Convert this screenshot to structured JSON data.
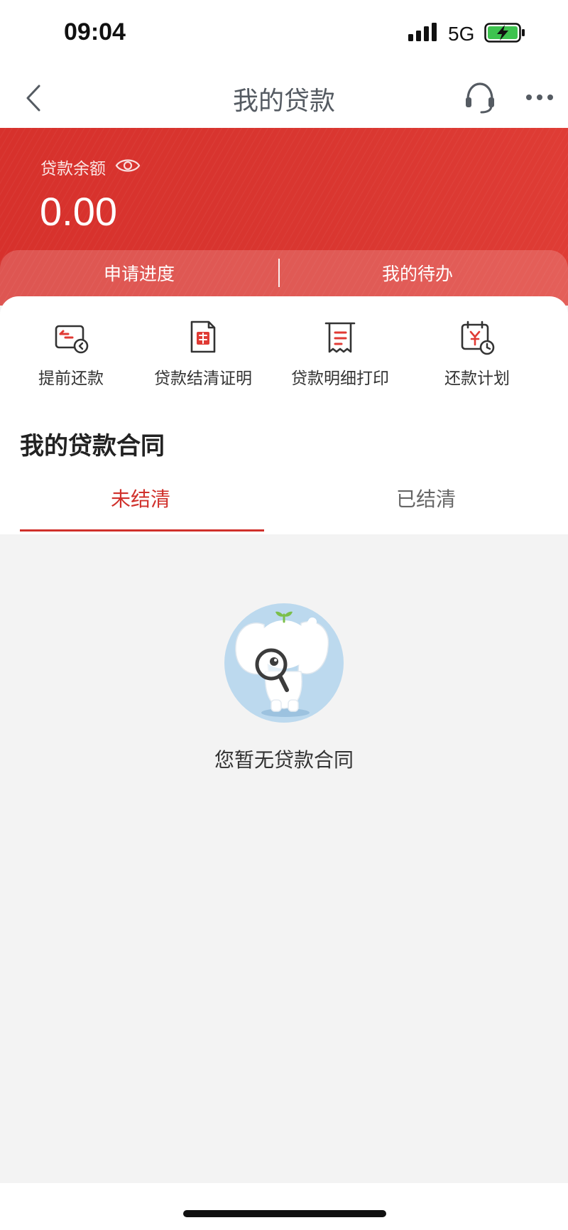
{
  "status_bar": {
    "time": "09:04",
    "network": "5G",
    "signal_icon": "cellular-signal-icon",
    "battery_icon": "battery-charging-icon"
  },
  "nav": {
    "title": "我的贷款",
    "back_icon": "chevron-left-icon",
    "service_icon": "headset-icon",
    "more_icon": "more-dots-icon"
  },
  "banner": {
    "balance_label": "贷款余额",
    "balance_value": "0.00",
    "visibility_icon": "eye-icon",
    "tabs": [
      {
        "label": "申请进度"
      },
      {
        "label": "我的待办"
      }
    ]
  },
  "quick_actions": [
    {
      "label": "提前还款",
      "icon": "early-repay-icon"
    },
    {
      "label": "贷款结清证明",
      "icon": "settlement-certificate-icon"
    },
    {
      "label": "贷款明细打印",
      "icon": "receipt-print-icon"
    },
    {
      "label": "还款计划",
      "icon": "repayment-calendar-icon"
    }
  ],
  "contracts": {
    "title": "我的贷款合同",
    "tabs": [
      {
        "label": "未结清",
        "active": true
      },
      {
        "label": "已结清",
        "active": false
      }
    ],
    "empty_text": "您暂无贷款合同"
  },
  "colors": {
    "brand_red": "#d0302b",
    "background": "#f3f3f3"
  }
}
